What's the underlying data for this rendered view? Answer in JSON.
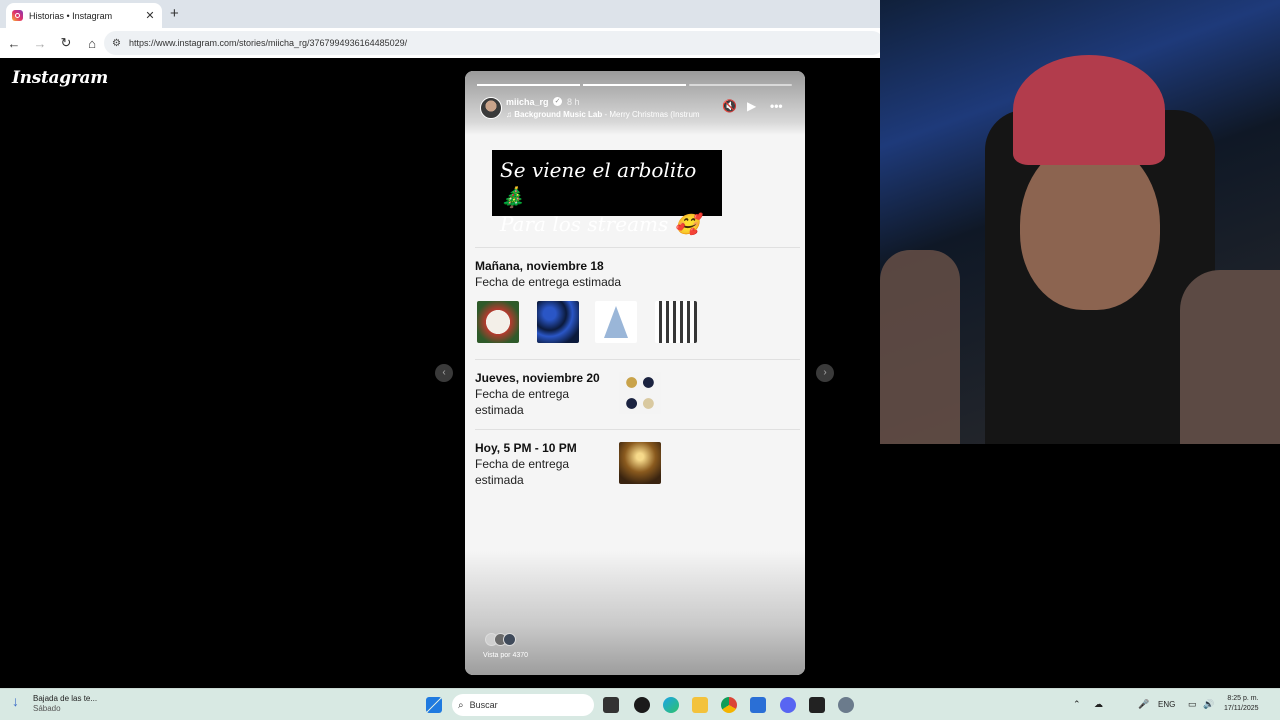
{
  "browser": {
    "tab_title": "Historias • Instagram",
    "tab_close": "✕",
    "new_tab": "+",
    "url": "https://www.instagram.com/stories/miicha_rg/3767994936164485029/"
  },
  "instagram": {
    "logo": "Instagram",
    "story": {
      "username": "miicha_rg",
      "time_ago": "8 h",
      "music_artist": "Background Music Lab",
      "music_track": " - Merry Christmas (Instrum",
      "progress": [
        1.0,
        1.0,
        0.0
      ],
      "banner_line1": "Se viene el arbolito 🎄",
      "banner_line2": "Para los streams 🥰",
      "deliveries": [
        {
          "heading": "Mañana, noviembre 18",
          "sub": "Fecha de entrega estimada"
        },
        {
          "heading": "Jueves, noviembre 20",
          "sub": "Fecha de entrega estimada"
        },
        {
          "heading": "Hoy, 5 PM - 10 PM",
          "sub": "Fecha de entrega estimada"
        }
      ],
      "views": "Vista por 4370"
    }
  },
  "taskbar": {
    "weather_line1": "Bajada de las te...",
    "weather_line2": "Sábado",
    "search_placeholder": "Buscar",
    "language": "ENG",
    "time": "8:25 p. m.",
    "date": "17/11/2025"
  },
  "colors": {
    "story_bg": "#f5f5f5",
    "taskbar_bg": "#d8e9e3"
  },
  "icons": [
    "back-icon",
    "forward-icon",
    "reload-icon",
    "home-icon",
    "mute-icon",
    "play-icon",
    "more-icon",
    "windows-start-icon",
    "search-icon"
  ]
}
